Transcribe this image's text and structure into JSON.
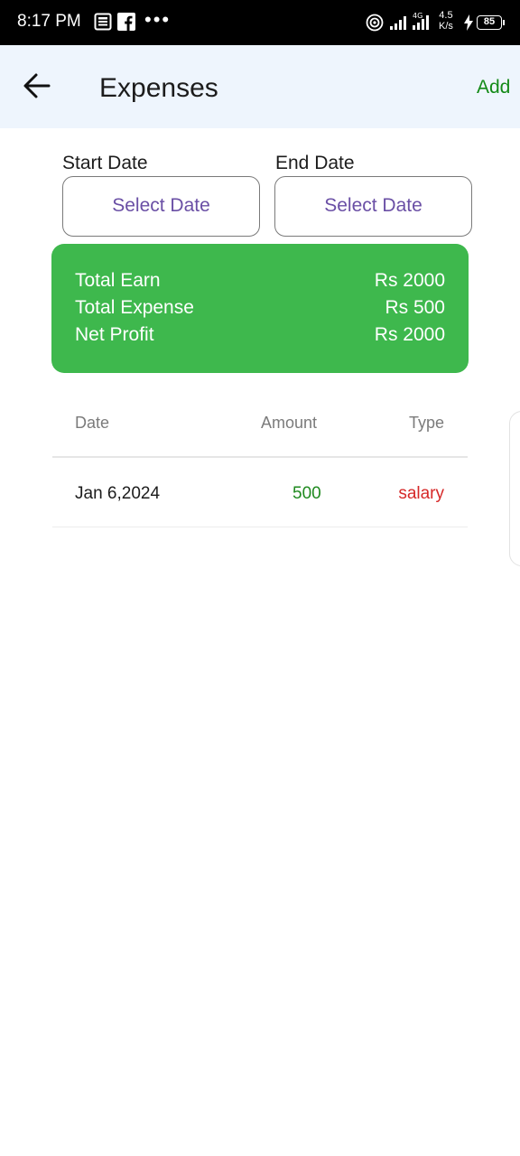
{
  "status_bar": {
    "time": "8:17 PM",
    "net_speed_value": "4.5",
    "net_speed_unit": "K/s",
    "network_type": "4G",
    "battery": "85"
  },
  "app_bar": {
    "title": "Expenses",
    "add_label": "Add"
  },
  "filters": {
    "start_label": "Start Date",
    "end_label": "End Date",
    "start_value": "Select Date",
    "end_value": "Select Date"
  },
  "summary": {
    "rows": [
      {
        "label": "Total Earn",
        "value": "Rs 2000"
      },
      {
        "label": "Total Expense",
        "value": "Rs 500"
      },
      {
        "label": "Net Profit",
        "value": "Rs 2000"
      }
    ]
  },
  "table": {
    "columns": [
      "Date",
      "Amount",
      "Type"
    ],
    "rows": [
      {
        "date": "Jan 6,2024",
        "amount": "500",
        "type": "salary"
      }
    ]
  },
  "colors": {
    "accent_green": "#138a17",
    "card_green": "#3eb84d",
    "amount_green": "#1f8a1f",
    "type_red": "#d62828",
    "button_text_purple": "#6a4fa5",
    "app_bar_bg": "#eef5fd"
  }
}
